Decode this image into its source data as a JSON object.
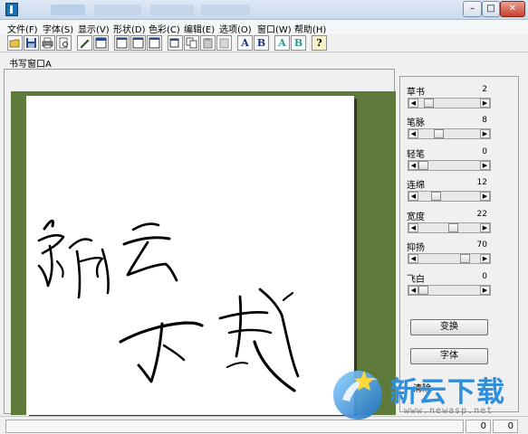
{
  "menus": [
    "文件(F)",
    "字体(S)",
    "显示(V)",
    "形状(D)",
    "色彩(C)",
    "编辑(E)",
    "选项(O)",
    "窗口(W)",
    "帮助(H)"
  ],
  "window_controls": {
    "minimize": "–",
    "maximize": "□",
    "close": "✕"
  },
  "toolbar": {
    "font_a": "A",
    "font_b": "B",
    "color_a": "A",
    "color_b": "B",
    "help": "?"
  },
  "document": {
    "title": "书写窗口A"
  },
  "panel": {
    "sliders": [
      {
        "label": "草书",
        "value": "2",
        "position": 0.1
      },
      {
        "label": "笔脉",
        "value": "8",
        "position": 0.3
      },
      {
        "label": "轻笔",
        "value": "0",
        "position": 0.0
      },
      {
        "label": "连绵",
        "value": "12",
        "position": 0.25
      },
      {
        "label": "宽度",
        "value": "22",
        "position": 0.58
      },
      {
        "label": "抑扬",
        "value": "70",
        "position": 0.8
      },
      {
        "label": "飞白",
        "value": "0",
        "position": 0.0
      }
    ],
    "buttons": {
      "transform": "变换",
      "font": "字体"
    },
    "clear_link": "清除"
  },
  "status": {
    "cell1": "0",
    "cell2": "0"
  },
  "watermark": {
    "text": "新云下载",
    "url": "www.newasp.net"
  },
  "colors": {
    "canvas_bg": "#5e7a3a",
    "accent": "#2f8fdc"
  }
}
